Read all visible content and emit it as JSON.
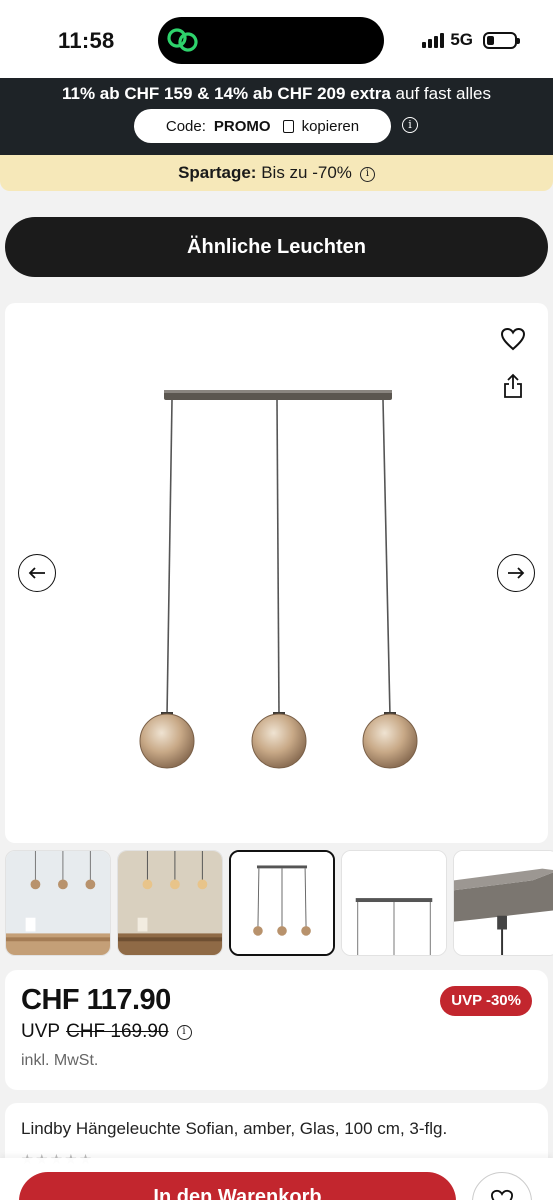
{
  "status_bar": {
    "time": "11:58",
    "network": "5G"
  },
  "promo": {
    "line_bold": "11% ab CHF 159 & 14% ab CHF 209 extra",
    "line_rest": " auf fast alles",
    "code_label": "Code:",
    "code_value": "PROMO",
    "copy_label": "kopieren"
  },
  "spartage": {
    "label": "Spartage:",
    "text": " Bis zu -70%"
  },
  "similar_button": "Ähnliche Leuchten",
  "product": {
    "price": "CHF 117.90",
    "uvp_label": "UVP",
    "uvp_price": "CHF 169.90",
    "tax_note": "inkl. MwSt.",
    "discount_badge": "UVP -30%",
    "title": "Lindby Hängeleuchte Sofian, amber, Glas, 100 cm, 3-flg.",
    "rating_stars": "★★★★★"
  },
  "cart_button": "In den Warenkorb",
  "icons": [
    "heart-icon",
    "share-icon",
    "arrow-left-icon",
    "arrow-right-icon",
    "info-icon",
    "copy-icon"
  ],
  "colors": {
    "accent_red": "#c2262e",
    "dark": "#1b1b1b",
    "banner_yellow": "#f6e8b9"
  }
}
